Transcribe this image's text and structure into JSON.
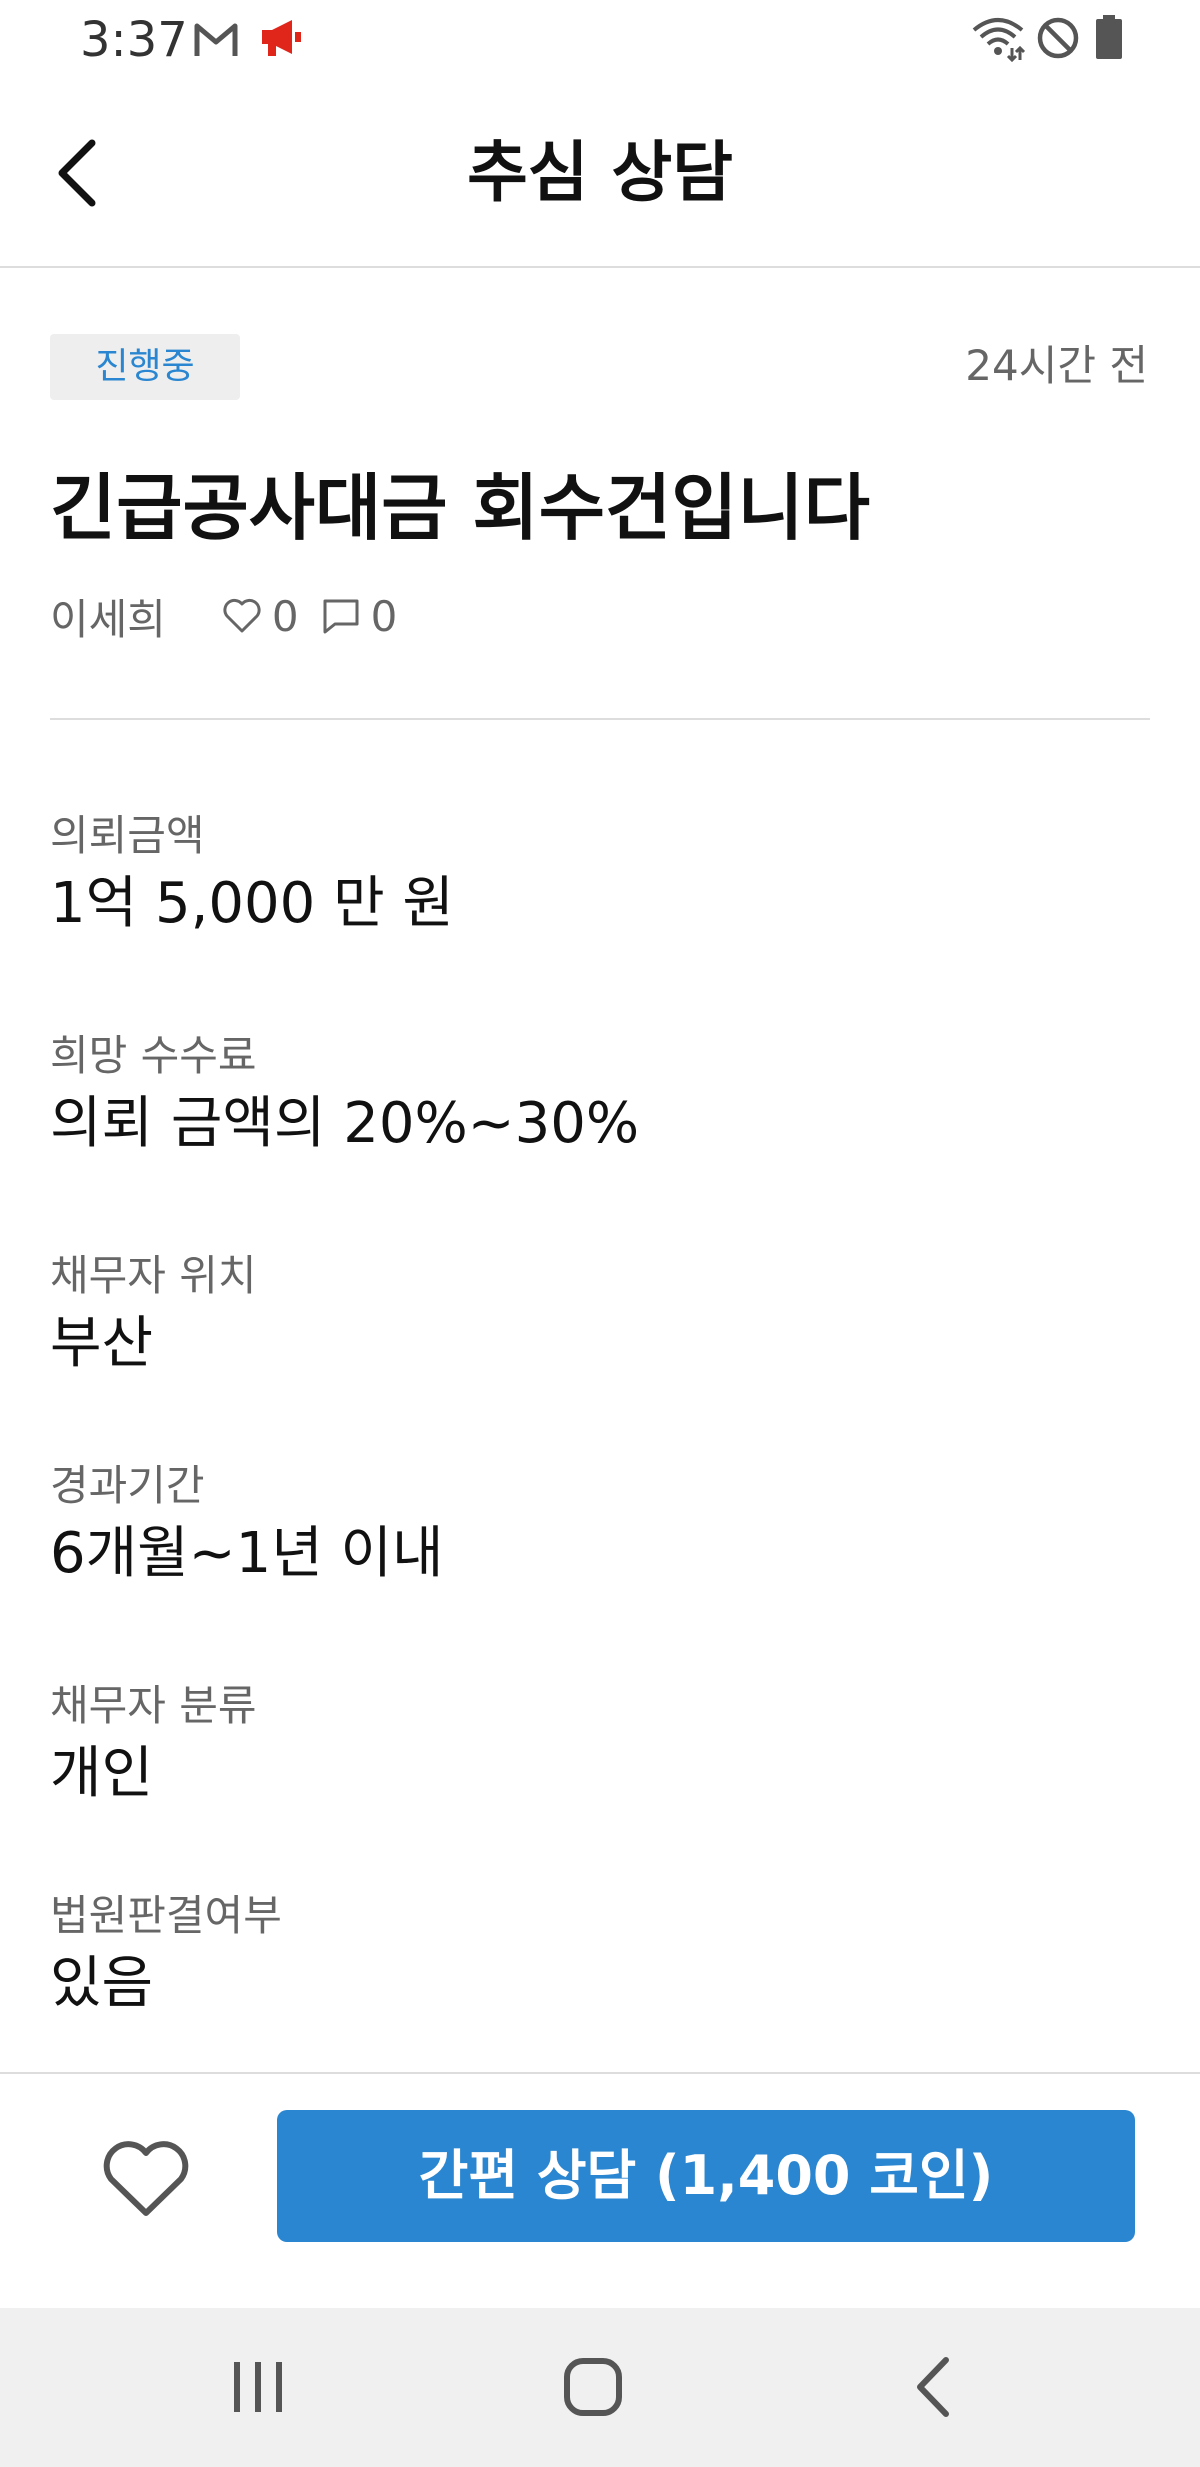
{
  "status_bar": {
    "time": "3:37",
    "icons": [
      "gmail-icon",
      "megaphone-icon",
      "wifi-icon",
      "do-not-disturb-icon",
      "battery-icon"
    ]
  },
  "header": {
    "title": "추심 상담",
    "back_icon": "chevron-left-icon"
  },
  "post": {
    "status_badge": "진행중",
    "time_ago": "24시간 전",
    "title": "긴급공사대금 회수건입니다",
    "author": "이세희",
    "likes": "0",
    "comments": "0"
  },
  "details": [
    {
      "label": "의뢰금액",
      "value": "1억 5,000 만 원"
    },
    {
      "label": "희망 수수료",
      "value": "의뢰 금액의 20%~30%"
    },
    {
      "label": "채무자 위치",
      "value": "부산"
    },
    {
      "label": "경과기간",
      "value": "6개월~1년 이내"
    },
    {
      "label": "채무자 분류",
      "value": "개인"
    },
    {
      "label": "법원판결여부",
      "value": "있음"
    }
  ],
  "action_bar": {
    "favorite_icon": "heart-outline-icon",
    "consult_button": "간편 상담 (1,400 코인)"
  },
  "nav_bar": {
    "icons": [
      "recent-apps-icon",
      "home-icon",
      "back-icon"
    ]
  },
  "colors": {
    "accent": "#2a86d0",
    "badge_bg": "#eeeeee",
    "megaphone": "#e0261b",
    "muted_text": "#666666",
    "nav_bg": "#f0f0f0"
  }
}
